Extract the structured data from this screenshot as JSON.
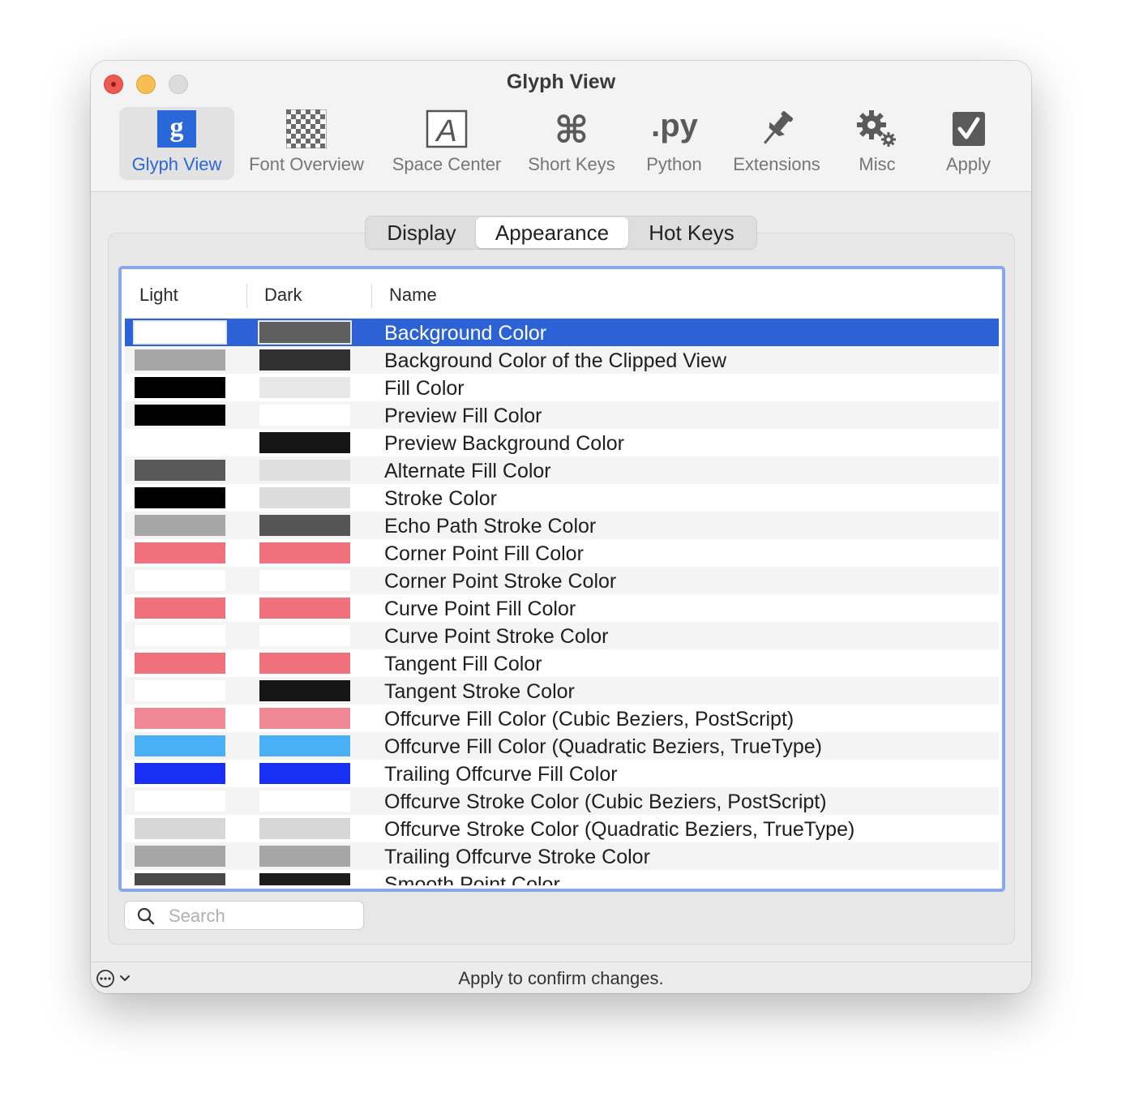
{
  "window": {
    "title": "Glyph View"
  },
  "toolbar": {
    "items": [
      {
        "label": "Glyph View",
        "icon": "glyph-view-icon",
        "active": true
      },
      {
        "label": "Font Overview",
        "icon": "checkerboard-icon",
        "active": false
      },
      {
        "label": "Space Center",
        "icon": "space-center-icon",
        "active": false
      },
      {
        "label": "Short Keys",
        "icon": "command-key-icon",
        "active": false
      },
      {
        "label": "Python",
        "icon": "python-py-icon",
        "active": false
      },
      {
        "label": "Extensions",
        "icon": "pushpin-icon",
        "active": false
      },
      {
        "label": "Misc",
        "icon": "gears-icon",
        "active": false
      },
      {
        "label": "Apply",
        "icon": "apply-checkmark-icon",
        "active": false
      }
    ]
  },
  "tabs": [
    {
      "label": "Display",
      "selected": false
    },
    {
      "label": "Appearance",
      "selected": true
    },
    {
      "label": "Hot Keys",
      "selected": false
    }
  ],
  "table": {
    "columns": {
      "light": "Light",
      "dark": "Dark",
      "name": "Name"
    },
    "rows": [
      {
        "name": "Background Color",
        "light": "#ffffff",
        "dark": "#5f5f5f",
        "selected": true
      },
      {
        "name": "Background Color of the Clipped View",
        "light": "#a6a6a6",
        "dark": "#303030"
      },
      {
        "name": "Fill Color",
        "light": "#000000",
        "dark": "#e8e8e8"
      },
      {
        "name": "Preview Fill Color",
        "light": "#000000",
        "dark": "#ffffff"
      },
      {
        "name": "Preview Background Color",
        "light": "#ffffff",
        "dark": "#151515"
      },
      {
        "name": "Alternate Fill Color",
        "light": "#595959",
        "dark": "#dedede"
      },
      {
        "name": "Stroke Color",
        "light": "#000000",
        "dark": "#dcdcdc"
      },
      {
        "name": "Echo Path Stroke Color",
        "light": "#a6a6a6",
        "dark": "#555555"
      },
      {
        "name": "Corner Point Fill Color",
        "light": "#f0707c",
        "dark": "#f0707c"
      },
      {
        "name": "Corner Point Stroke Color",
        "light": "#ffffff",
        "dark": "#ffffff"
      },
      {
        "name": "Curve Point Fill Color",
        "light": "#f0707c",
        "dark": "#f0707c"
      },
      {
        "name": "Curve Point Stroke Color",
        "light": "#ffffff",
        "dark": "#ffffff"
      },
      {
        "name": "Tangent Fill Color",
        "light": "#f0707c",
        "dark": "#f0707c"
      },
      {
        "name": "Tangent Stroke Color",
        "light": "#ffffff",
        "dark": "#151515"
      },
      {
        "name": "Offcurve Fill Color (Cubic Beziers, PostScript)",
        "light": "#f08895",
        "dark": "#f08895"
      },
      {
        "name": "Offcurve Fill Color (Quadratic Beziers, TrueType)",
        "light": "#4ab0f6",
        "dark": "#4ab0f6"
      },
      {
        "name": "Trailing Offcurve Fill Color",
        "light": "#1a2ff5",
        "dark": "#1a2ff5"
      },
      {
        "name": "Offcurve Stroke Color (Cubic Beziers, PostScript)",
        "light": "#ffffff",
        "dark": "#ffffff"
      },
      {
        "name": "Offcurve Stroke Color (Quadratic Beziers, TrueType)",
        "light": "#d7d7d7",
        "dark": "#d7d7d7"
      },
      {
        "name": "Trailing Offcurve Stroke Color",
        "light": "#a6a6a6",
        "dark": "#a6a6a6"
      },
      {
        "name": "Smooth Point Color",
        "light": "#4a4a4a",
        "dark": "#1c1c1c"
      }
    ]
  },
  "search": {
    "placeholder": "Search",
    "value": ""
  },
  "status": {
    "text": "Apply to confirm changes."
  },
  "colors": {
    "accent": "#2c62d6",
    "focus_ring": "#8aa8e8",
    "active_label": "#2a67d9"
  }
}
